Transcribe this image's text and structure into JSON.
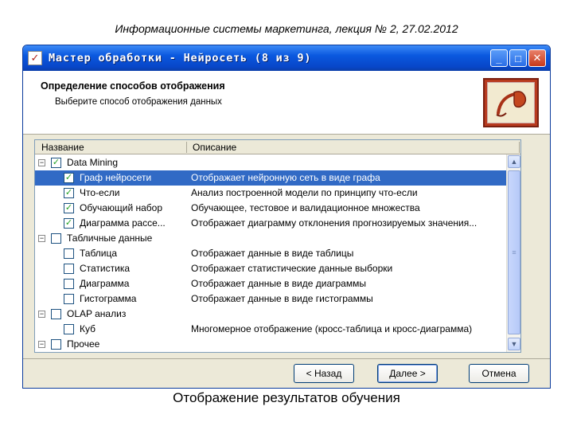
{
  "slide": {
    "header": "Информационные системы маркетинга, лекция № 2, 27.02.2012",
    "caption": "Отображение результатов обучения"
  },
  "window": {
    "title": "Мастер обработки - Нейросеть (8 из 9)",
    "step_title": "Определение способов отображения",
    "step_subtitle": "Выберите способ отображения данных",
    "columns": {
      "name": "Название",
      "description": "Описание"
    },
    "rows": [
      {
        "level": 0,
        "expander": "−",
        "checked": true,
        "name": "Data Mining",
        "description": "",
        "selected": false
      },
      {
        "level": 1,
        "checked": true,
        "name": "Граф нейросети",
        "description": "Отображает нейронную сеть в виде графа",
        "selected": true
      },
      {
        "level": 1,
        "checked": true,
        "name": "Что-если",
        "description": "Анализ построенной модели по принципу что-если",
        "selected": false
      },
      {
        "level": 1,
        "checked": true,
        "name": "Обучающий набор",
        "description": "Обучающее, тестовое и валидационное множества",
        "selected": false
      },
      {
        "level": 1,
        "checked": true,
        "name": "Диаграмма рассе...",
        "description": "Отображает диаграмму отклонения прогнозируемых значения...",
        "selected": false
      },
      {
        "level": 0,
        "expander": "−",
        "checked": false,
        "name": "Табличные данные",
        "description": "",
        "selected": false
      },
      {
        "level": 1,
        "checked": false,
        "name": "Таблица",
        "description": "Отображает данные в виде таблицы",
        "selected": false
      },
      {
        "level": 1,
        "checked": false,
        "name": "Статистика",
        "description": "Отображает статистические данные выборки",
        "selected": false
      },
      {
        "level": 1,
        "checked": false,
        "name": "Диаграмма",
        "description": "Отображает данные в виде диаграммы",
        "selected": false
      },
      {
        "level": 1,
        "checked": false,
        "name": "Гистограмма",
        "description": "Отображает данные в виде гистограммы",
        "selected": false
      },
      {
        "level": 0,
        "expander": "−",
        "checked": false,
        "name": "OLAP анализ",
        "description": "",
        "selected": false
      },
      {
        "level": 1,
        "checked": false,
        "name": "Куб",
        "description": "Многомерное отображение (кросс-таблица и кросс-диаграмма)",
        "selected": false
      },
      {
        "level": 0,
        "expander": "−",
        "checked": false,
        "name": "Прочее",
        "description": "",
        "selected": false
      }
    ],
    "buttons": {
      "back": "< Назад",
      "next": "Далее >",
      "cancel": "Отмена"
    },
    "icons": {
      "app": "wizard-icon",
      "logo": "pipe-logo-icon",
      "minimize": "minimize-icon",
      "maximize": "maximize-icon",
      "close": "close-icon"
    },
    "colors": {
      "titlebar": "#0a58df",
      "selection": "#316ac5",
      "logo_frame": "#b83a1e",
      "check": "#21a121"
    }
  }
}
